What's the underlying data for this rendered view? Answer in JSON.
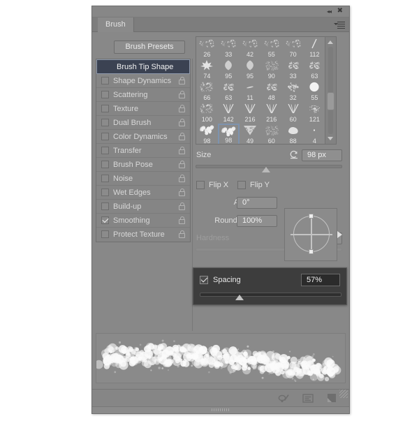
{
  "window": {
    "title": "Brush",
    "collapse_icon": "collapse-arrows-icon",
    "close_icon": "close-icon",
    "menu_icon": "panel-menu-icon"
  },
  "tabs": [
    {
      "label": "Brush",
      "active": true
    }
  ],
  "presets_button": {
    "label": "Brush Presets"
  },
  "options": [
    {
      "label": "Brush Tip Shape",
      "checked": false,
      "selected": true,
      "has_checkbox": false,
      "has_lock": false
    },
    {
      "label": "Shape Dynamics",
      "checked": false,
      "selected": false,
      "has_checkbox": true,
      "has_lock": true
    },
    {
      "label": "Scattering",
      "checked": false,
      "selected": false,
      "has_checkbox": true,
      "has_lock": true
    },
    {
      "label": "Texture",
      "checked": false,
      "selected": false,
      "has_checkbox": true,
      "has_lock": true
    },
    {
      "label": "Dual Brush",
      "checked": false,
      "selected": false,
      "has_checkbox": true,
      "has_lock": true
    },
    {
      "label": "Color Dynamics",
      "checked": false,
      "selected": false,
      "has_checkbox": true,
      "has_lock": true
    },
    {
      "label": "Transfer",
      "checked": false,
      "selected": false,
      "has_checkbox": true,
      "has_lock": true
    },
    {
      "label": "Brush Pose",
      "checked": false,
      "selected": false,
      "has_checkbox": true,
      "has_lock": true
    },
    {
      "label": "Noise",
      "checked": false,
      "selected": false,
      "has_checkbox": true,
      "has_lock": true
    },
    {
      "label": "Wet Edges",
      "checked": false,
      "selected": false,
      "has_checkbox": true,
      "has_lock": true
    },
    {
      "label": "Build-up",
      "checked": false,
      "selected": false,
      "has_checkbox": true,
      "has_lock": true
    },
    {
      "label": "Smoothing",
      "checked": true,
      "selected": false,
      "has_checkbox": true,
      "has_lock": true
    },
    {
      "label": "Protect Texture",
      "checked": false,
      "selected": false,
      "has_checkbox": true,
      "has_lock": true
    }
  ],
  "brush_grid": {
    "selected_index": 25,
    "rows": [
      [
        {
          "size": "26",
          "shape": "speckle"
        },
        {
          "size": "33",
          "shape": "speckle"
        },
        {
          "size": "42",
          "shape": "speckle"
        },
        {
          "size": "55",
          "shape": "speckle"
        },
        {
          "size": "70",
          "shape": "speckle"
        },
        {
          "size": "112",
          "shape": "slash"
        }
      ],
      [
        {
          "size": "74",
          "shape": "leaf-maple"
        },
        {
          "size": "95",
          "shape": "leaf-round"
        },
        {
          "size": "95",
          "shape": "leaf-round"
        },
        {
          "size": "90",
          "shape": "grain-dense"
        },
        {
          "size": "33",
          "shape": "scatter-small"
        },
        {
          "size": "63",
          "shape": "scatter-small"
        }
      ],
      [
        {
          "size": "66",
          "shape": "grain-soft"
        },
        {
          "size": "63",
          "shape": "scatter-small"
        },
        {
          "size": "11",
          "shape": "dash"
        },
        {
          "size": "48",
          "shape": "scatter-small"
        },
        {
          "size": "32",
          "shape": "star-scatter"
        },
        {
          "size": "55",
          "shape": "circle-solid"
        }
      ],
      [
        {
          "size": "100",
          "shape": "grain-soft"
        },
        {
          "size": "142",
          "shape": "grass-v"
        },
        {
          "size": "216",
          "shape": "grass-v"
        },
        {
          "size": "216",
          "shape": "grass-v"
        },
        {
          "size": "60",
          "shape": "grass-v"
        },
        {
          "size": "121",
          "shape": "spray"
        }
      ],
      [
        {
          "size": "98",
          "shape": "cloud-puff"
        },
        {
          "size": "98",
          "shape": "cloud-puff"
        },
        {
          "size": "49",
          "shape": "triangle-tex"
        },
        {
          "size": "60",
          "shape": "grain-dense"
        },
        {
          "size": "88",
          "shape": "smudge"
        },
        {
          "size": "4",
          "shape": "dot"
        }
      ]
    ],
    "scrollbar": {
      "up_icon": "scroll-up-arrow-icon",
      "down_icon": "scroll-down-arrow-icon"
    }
  },
  "controls": {
    "size": {
      "label": "Size",
      "value": "98 px",
      "reset_icon": "reset-size-icon",
      "slider_percent": 48
    },
    "flip_x": {
      "label": "Flip X",
      "checked": false
    },
    "flip_y": {
      "label": "Flip Y",
      "checked": false
    },
    "angle": {
      "label": "Angle:",
      "value": "0°"
    },
    "roundness": {
      "label": "Roundness:",
      "value": "100%"
    },
    "hardness": {
      "label": "Hardness",
      "value": "",
      "disabled": true,
      "slider_percent": 0
    },
    "spacing": {
      "label": "Spacing",
      "value": "57%",
      "checked": true,
      "slider_percent": 28,
      "highlighted": true
    }
  },
  "footer": {
    "icons": [
      {
        "name": "toggle-brush-stroke-icon"
      },
      {
        "name": "preset-manager-icon"
      },
      {
        "name": "new-brush-icon"
      }
    ],
    "grip": "panel-grip-handle",
    "resize": "resize-corner-handle"
  },
  "preview": {
    "label": "brush-stroke-preview",
    "stroke_shape": "cloud-puff-stroke"
  }
}
